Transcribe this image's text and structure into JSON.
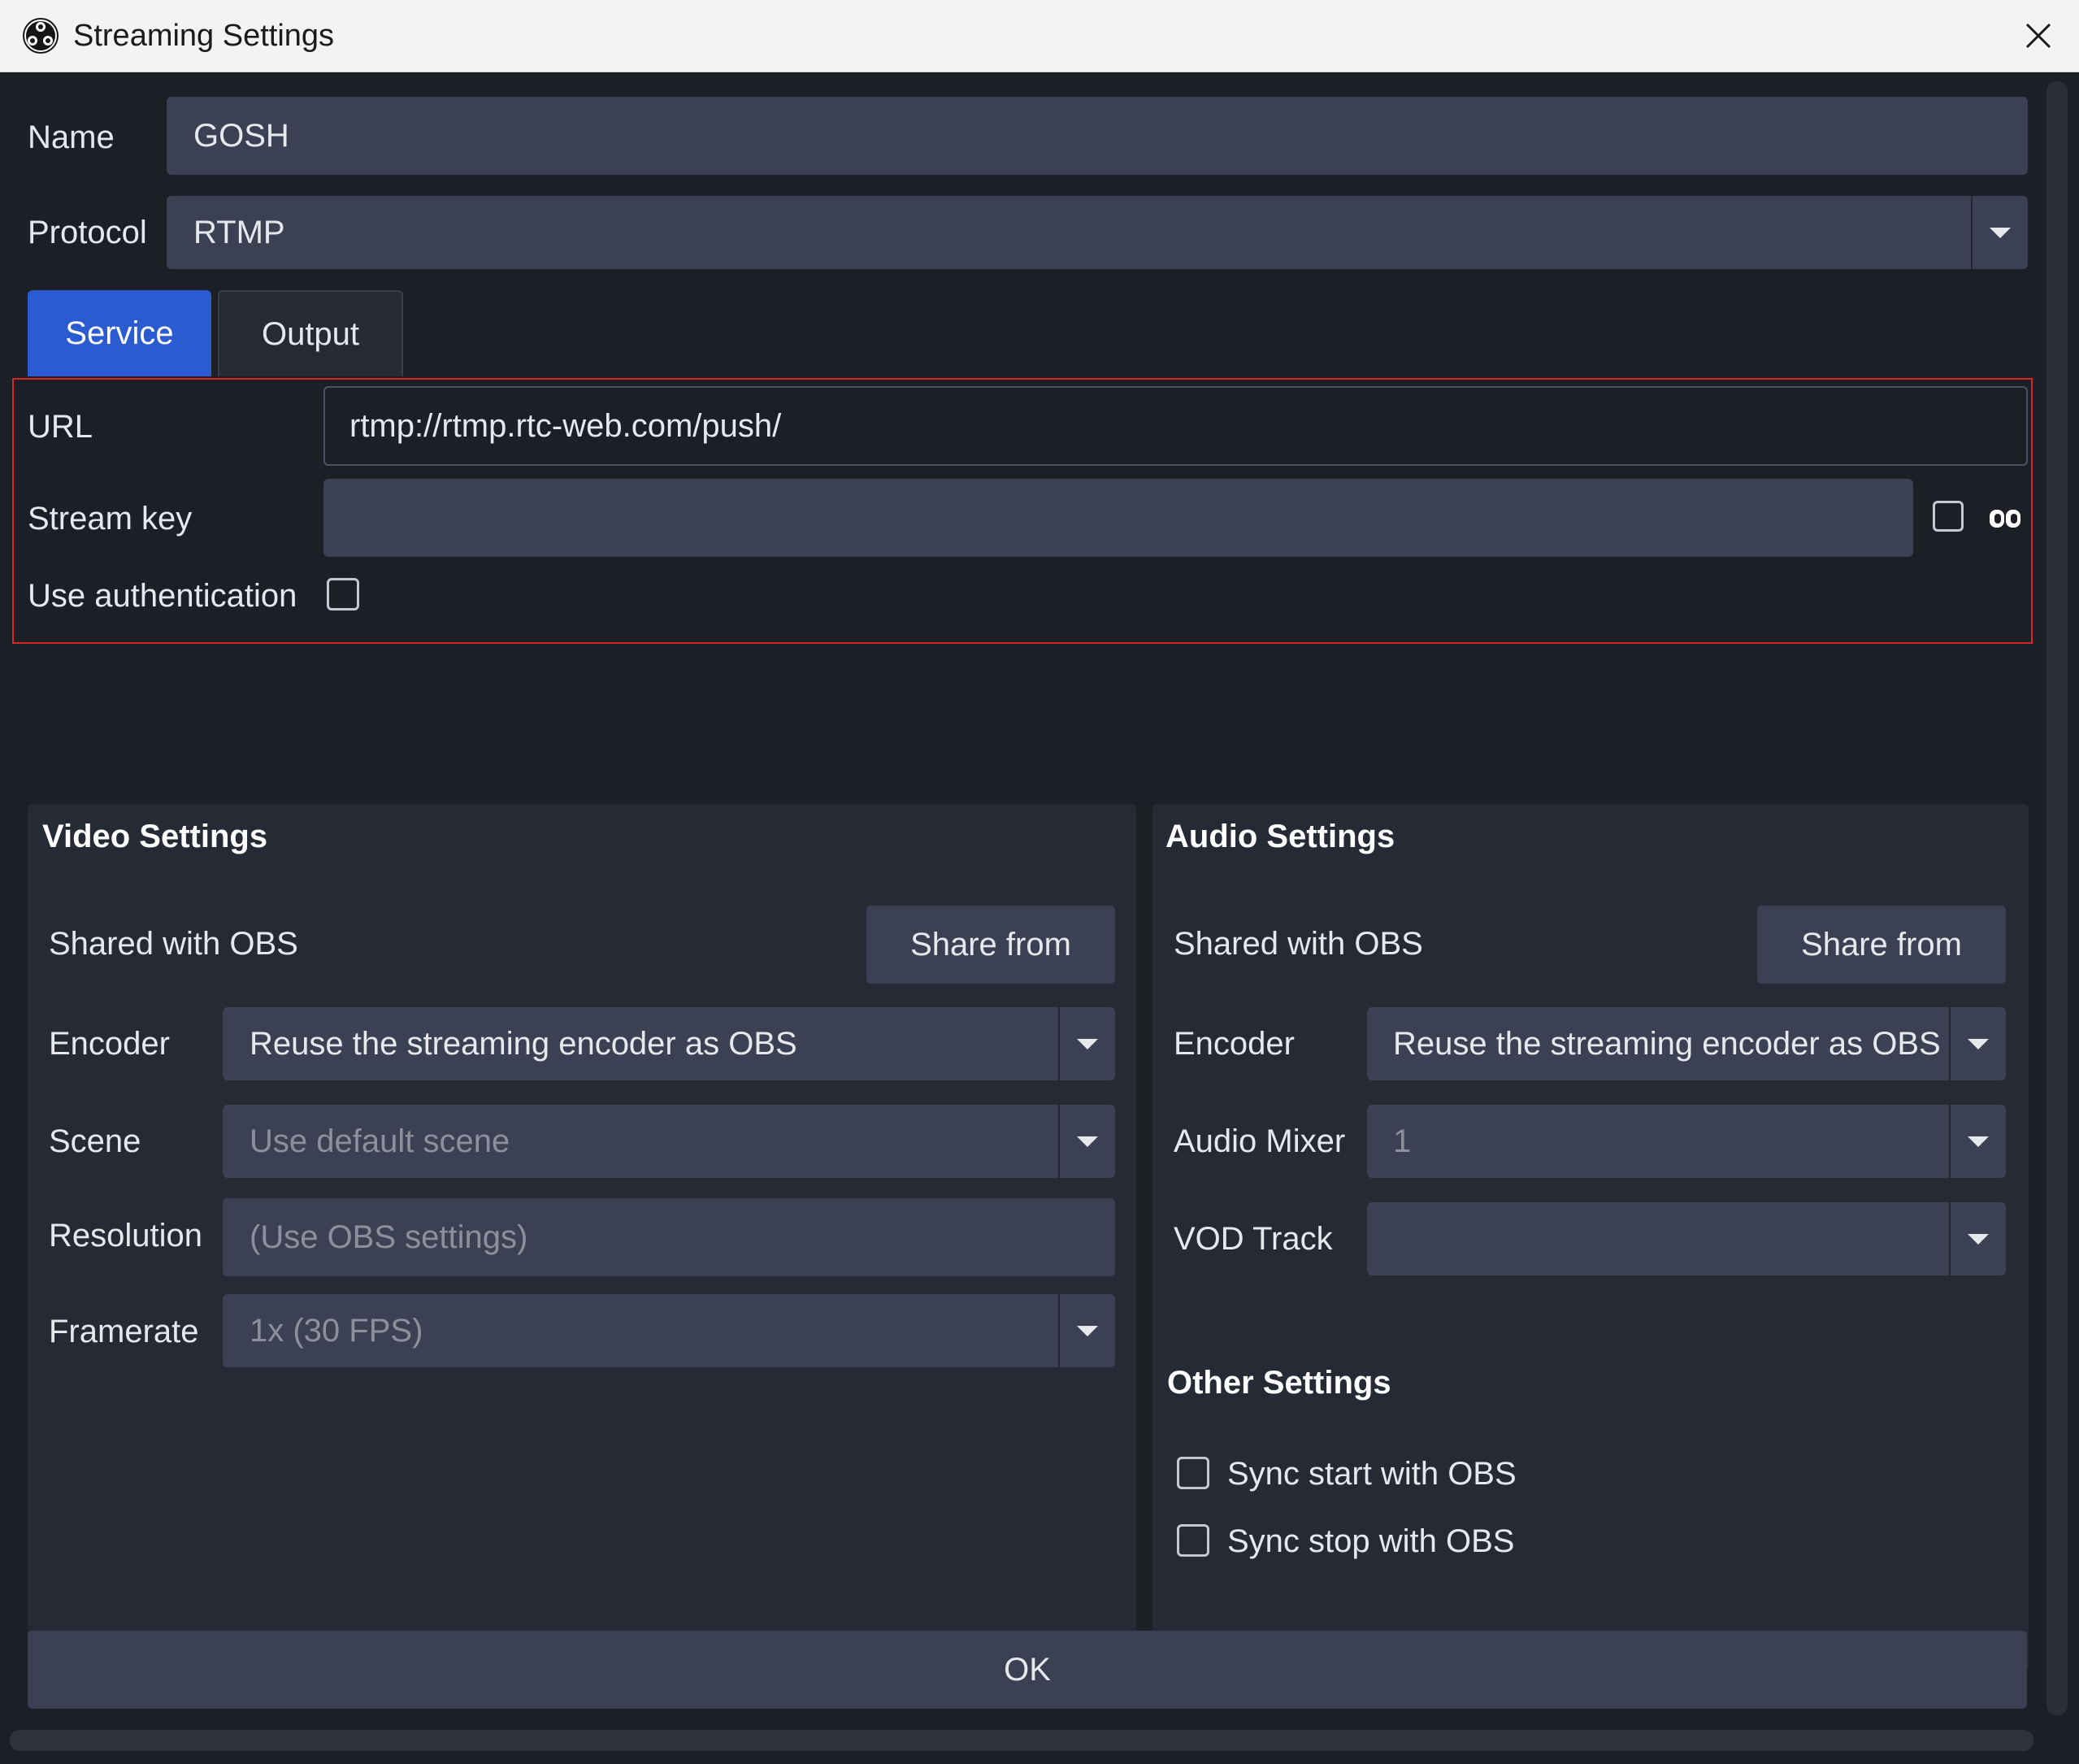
{
  "window": {
    "title": "Streaming Settings",
    "app_icon": "obs-logo-icon",
    "close_icon": "close-icon"
  },
  "name_row": {
    "label": "Name",
    "value": "GOSH"
  },
  "protocol_row": {
    "label": "Protocol",
    "value": "RTMP"
  },
  "tabs": [
    {
      "label": "Service",
      "active": true
    },
    {
      "label": "Output",
      "active": false
    }
  ],
  "service": {
    "url_label": "URL",
    "url_value": "rtmp://rtmp.rtc-web.com/push/",
    "stream_key_label": "Stream key",
    "stream_key_value": "",
    "show_key_checked": false,
    "use_auth_label": "Use authentication",
    "use_auth_checked": false
  },
  "video_settings": {
    "title": "Video Settings",
    "shared_label": "Shared with OBS",
    "share_button": "Share from",
    "encoder_label": "Encoder",
    "encoder_value": "Reuse the streaming encoder as OBS",
    "scene_label": "Scene",
    "scene_value": "Use default scene",
    "resolution_label": "Resolution",
    "resolution_value": "(Use OBS settings)",
    "framerate_label": "Framerate",
    "framerate_value": "1x (30 FPS)"
  },
  "audio_settings": {
    "title": "Audio Settings",
    "shared_label": "Shared with OBS",
    "share_button": "Share from",
    "encoder_label": "Encoder",
    "encoder_value": "Reuse the streaming encoder as OBS",
    "mixer_label": "Audio Mixer",
    "mixer_value": "1",
    "vod_label": "VOD Track",
    "vod_value": ""
  },
  "other_settings": {
    "title": "Other Settings",
    "sync_start_label": "Sync start with OBS",
    "sync_start_checked": false,
    "sync_stop_label": "Sync stop with OBS",
    "sync_stop_checked": false
  },
  "ok_button": "OK",
  "colors": {
    "background": "#1d1f26",
    "panel": "#262a35",
    "field": "#3b4152",
    "accent": "#2a5bd0",
    "highlight_border": "#d62626"
  }
}
